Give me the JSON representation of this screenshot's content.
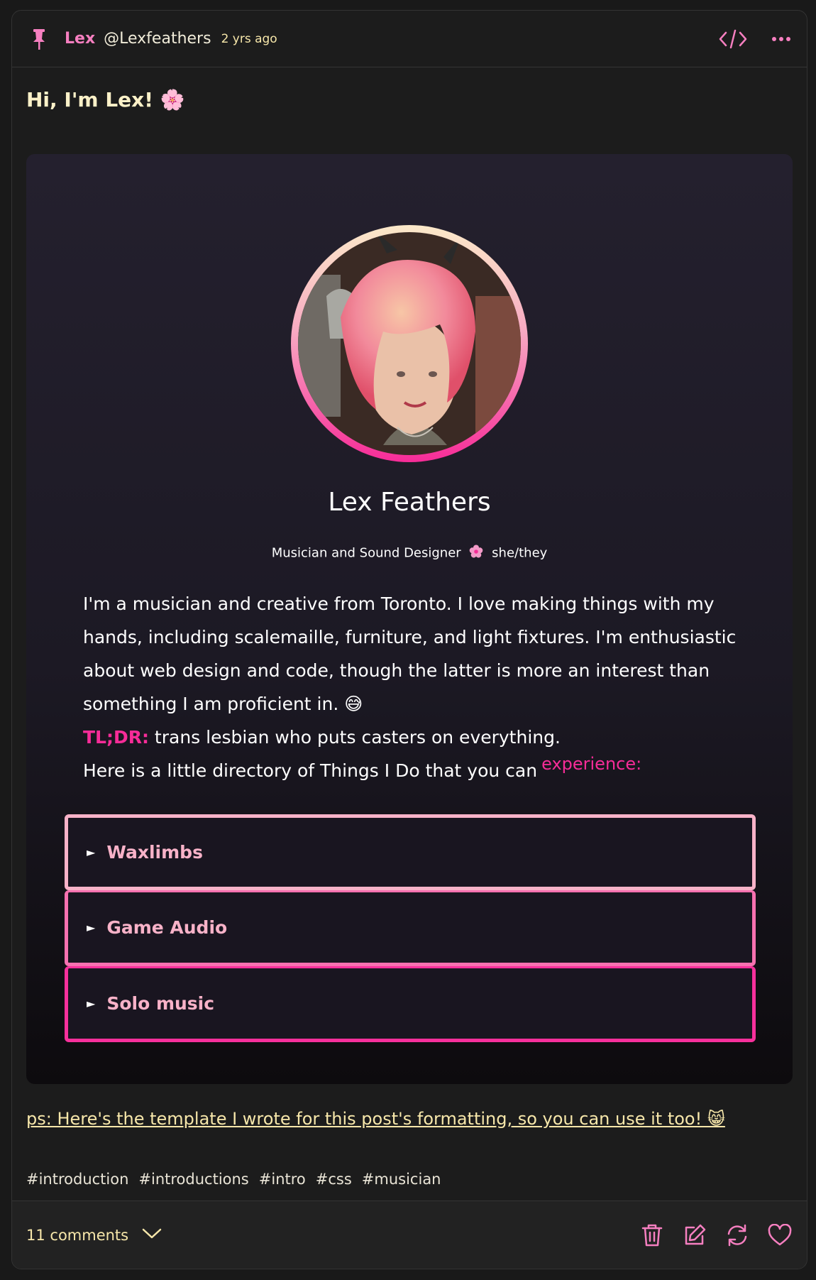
{
  "colors": {
    "accent_pink": "#f67fc0",
    "hot_pink": "#f72c98",
    "cream": "#f7e7aa",
    "background": "#1c1c1c"
  },
  "header": {
    "pin_icon": "pin-icon",
    "author_name": "Lex",
    "author_handle": "@Lexfeathers",
    "time_ago": "2 yrs ago",
    "actions": [
      "code-icon",
      "more-icon"
    ]
  },
  "post": {
    "title": "Hi, I'm Lex! 🌸",
    "card": {
      "name": "Lex Feathers",
      "role": "Musician and Sound Designer",
      "pronouns": "she/they",
      "bio_paragraph": "I'm a musician and creative from Toronto. I love making things with my hands, including scalemaille, furniture, and light fixtures. I'm enthusiastic about web design and code, though the latter is more an interest than something I am proficient in. 😅",
      "tldr_label": "TL;DR:",
      "tldr_text": " trans lesbian who puts casters on everything.",
      "directory_text": "Here is a little directory of Things I Do that you can",
      "directory_highlight": "experience:",
      "sections": [
        {
          "label": "Waxlimbs"
        },
        {
          "label": "Game Audio"
        },
        {
          "label": "Solo music"
        }
      ]
    },
    "ps_link": "ps: Here's the template I wrote for this post's formatting, so you can use it too! 😸",
    "tags": [
      "#introduction",
      "#introductions",
      "#intro",
      "#css",
      "#musician"
    ]
  },
  "footer": {
    "comments_label": "11 comments",
    "actions": [
      "trash-icon",
      "edit-icon",
      "share-icon",
      "like-icon"
    ]
  }
}
